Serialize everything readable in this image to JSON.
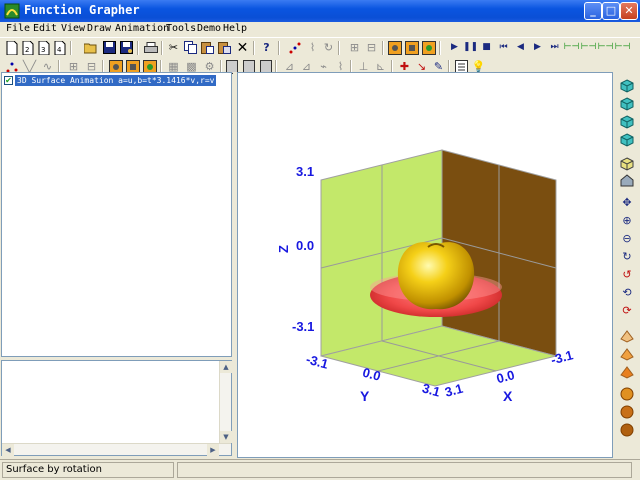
{
  "window": {
    "title": "Function Grapher",
    "minimize": "_",
    "maximize": "□",
    "close": "✕"
  },
  "menu": [
    "File",
    "Edit",
    "View",
    "Draw",
    "Animation",
    "Tools",
    "Demo",
    "Help"
  ],
  "tree": {
    "items": [
      {
        "label": "3D Surface Animation  a=u,b=t*3.1416*v,r=v",
        "checked": true
      }
    ]
  },
  "graph": {
    "axis_x_label": "X",
    "axis_y_label": "Y",
    "axis_z_label": "Z",
    "z_ticks": [
      "3.1",
      "0.0",
      "-3.1"
    ],
    "y_ticks": [
      "-3.1",
      "0.0",
      "3.1"
    ],
    "x_ticks": [
      "3.1",
      "0.0",
      "-3.1"
    ],
    "colors": {
      "wall": "#c3e86a",
      "back_wall": "#7a4e10",
      "surface_top": "#f0d020",
      "surface_disc": "#f04848",
      "labels": "#1818e0"
    }
  },
  "status": {
    "text": "Surface by rotation"
  },
  "icons": {
    "toolbar1": [
      "new-icon",
      "new-icon",
      "new-icon",
      "new-icon",
      "open-icon",
      "save-icon",
      "save-as-icon",
      "print-icon",
      "cut-icon",
      "copy-icon",
      "paste-icon",
      "paste-special-icon",
      "delete-icon",
      "help-icon",
      "points-icon",
      "graph-icon",
      "refresh-icon",
      "graph-tool-icon",
      "graph-tool-icon",
      "color-icon",
      "color-icon",
      "color-icon",
      "play-icon",
      "pause-icon",
      "stop-icon",
      "first-icon",
      "prev-icon",
      "next-icon",
      "last-icon",
      "step-icon",
      "step-icon",
      "step-icon",
      "step-icon"
    ],
    "toolbar2": [
      "point-icon",
      "line-icon",
      "curve-icon",
      "function-icon",
      "function-icon",
      "color-icon",
      "color-icon",
      "color-icon",
      "grid-icon",
      "grid-icon",
      "settings-icon",
      "note-icon",
      "note-icon",
      "note-icon",
      "axis-icon",
      "axis-icon",
      "axis-icon",
      "axis-icon",
      "axis-icon",
      "tool-icon",
      "arrow-icon",
      "pen-icon",
      "list-icon",
      "light-icon"
    ],
    "right": [
      "cube-icon",
      "cube-icon",
      "cube-icon",
      "cube-icon",
      "cube-icon",
      "home-icon",
      "move-icon",
      "zoom-in-icon",
      "zoom-out-icon",
      "rotate-icon",
      "rotate-icon",
      "rotate-icon",
      "rotate-icon",
      "mesh-icon",
      "mesh-icon",
      "mesh-icon",
      "sphere-icon",
      "sphere-icon",
      "sphere-icon"
    ]
  }
}
